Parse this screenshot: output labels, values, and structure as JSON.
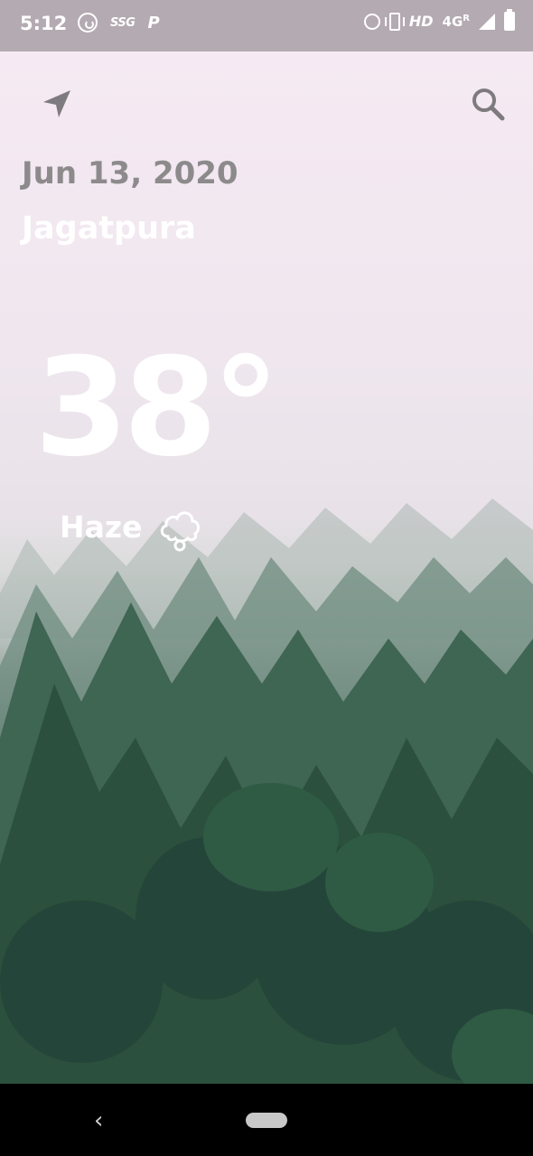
{
  "status_bar": {
    "time": "5:12",
    "icons_left": [
      "whatsapp-icon",
      "ssg-icon",
      "p-icon"
    ],
    "ssg_text": "SSG",
    "p_text": "P",
    "hd_text": "HD",
    "network_text": "4G",
    "roaming_text": "R",
    "icons_right": [
      "alarm-icon",
      "vibrate-icon",
      "signal-icon",
      "battery-icon"
    ]
  },
  "header": {
    "location_icon": "navigation-arrow-icon",
    "search_icon": "search-icon"
  },
  "weather": {
    "date": "Jun 13, 2020",
    "city": "Jagatpura",
    "temperature": "38°",
    "condition": "Haze",
    "condition_icon": "cloud-icon"
  },
  "nav_bar": {
    "back": "‹",
    "home_icon": "home-pill-icon"
  }
}
